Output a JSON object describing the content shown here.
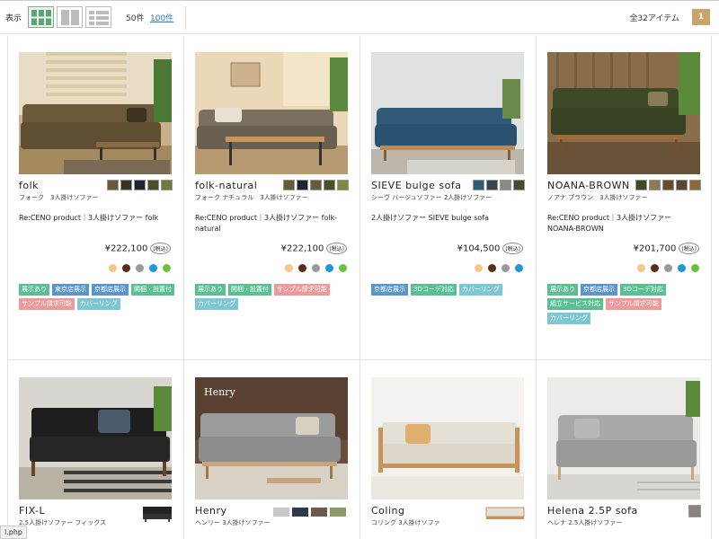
{
  "toolbar": {
    "display_label": "表示",
    "per_page_50": "50件",
    "per_page_100": "100件",
    "total": "全32アイテム",
    "page": "1"
  },
  "products": [
    {
      "name": "folk",
      "kana": "フォーク　3人掛けソファー",
      "desc": "Re:CENO product｜3人掛けソファー folk",
      "price": "¥222,100",
      "tax": "(税込)",
      "swatches": [
        "#6b5a3a",
        "#3b3226",
        "#1f2430",
        "#4a4f2a",
        "#6f7a3b"
      ],
      "dots": [
        "#f3c78a",
        "#5a2d16",
        "#9a9a9a",
        "#1a9ad6",
        "#6ac23a"
      ],
      "tags": [
        {
          "label": "展示あり",
          "color": "green"
        },
        {
          "label": "東京店展示",
          "color": "blue"
        },
        {
          "label": "京都店展示",
          "color": "blue"
        },
        {
          "label": "開梱・設置付",
          "color": "green"
        },
        {
          "label": "サンプル請求可能",
          "color": "pink"
        },
        {
          "label": "カバーリング",
          "color": "cyan"
        }
      ]
    },
    {
      "name": "folk-natural",
      "kana": "フォーク ナチュラル　3人掛けソファー",
      "desc": "Re:CENO product｜3人掛けソファー folk-natural",
      "price": "¥222,100",
      "tax": "(税込)",
      "swatches": [
        "#6b5a3a",
        "#1f2430",
        "#6a5a3a",
        "#4a4f2a",
        "#7d8a3b"
      ],
      "dots": [
        "#f3c78a",
        "#5a2d16",
        "#9a9a9a",
        "#1a9ad6",
        "#6ac23a"
      ],
      "tags": [
        {
          "label": "展示あり",
          "color": "green"
        },
        {
          "label": "開梱・設置付",
          "color": "green"
        },
        {
          "label": "サンプル請求可能",
          "color": "pink"
        },
        {
          "label": "カバーリング",
          "color": "cyan"
        }
      ]
    },
    {
      "name": "SIEVE bulge sofa",
      "kana": "シーヴ バージュソファー 2人掛けソファー",
      "desc": "2人掛けソファー SIEVE bulge sofa",
      "price": "¥104,500",
      "tax": "(税込)",
      "swatches": [
        "#2f5a78",
        "#3a4350",
        "#8a8a84",
        "#4b4a2f"
      ],
      "dots": [
        "#f3c78a",
        "#5a2d16",
        "#9a9a9a",
        "#1a9ad6"
      ],
      "tags": [
        {
          "label": "京都店展示",
          "color": "blue"
        },
        {
          "label": "3Dコーデ対応",
          "color": "green"
        },
        {
          "label": "カバーリング",
          "color": "cyan"
        }
      ]
    },
    {
      "name": "NOANA-BROWN",
      "kana": "ノアナ ブラウン　3人掛けソファー",
      "desc": "Re:CENO product｜3人掛けソファー NOANA-BROWN",
      "price": "¥201,700",
      "tax": "(税込)",
      "swatches": [
        "#3f4a28",
        "#8a7a55",
        "#6a4a2a",
        "#5a4630",
        "#8a6a3a"
      ],
      "dots": [
        "#f3c78a",
        "#5a2d16",
        "#9a9a9a",
        "#1a9ad6",
        "#6ac23a"
      ],
      "tags": [
        {
          "label": "展示あり",
          "color": "green"
        },
        {
          "label": "京都店展示",
          "color": "blue"
        },
        {
          "label": "3Dコーデ対応",
          "color": "green"
        },
        {
          "label": "組立サービス対応",
          "color": "green"
        },
        {
          "label": "サンプル請求可能",
          "color": "pink"
        },
        {
          "label": "カバーリング",
          "color": "cyan"
        }
      ]
    },
    {
      "name": "FIX-L",
      "kana": "2.5人掛けソファー フィックス",
      "thumb": "#222222"
    },
    {
      "name": "Henry",
      "kana": "ヘンリー 3人掛けソファー",
      "thumb": "#9a9a9a"
    },
    {
      "name": "Coling",
      "kana": "コリング 3人掛けソファ",
      "thumb": "#e5e0d6"
    },
    {
      "name": "Helena 2.5P sofa",
      "kana": "ヘレナ 2.5人掛けソファー",
      "thumb": "#8a8480"
    }
  ],
  "photo_overlay": {
    "henry_logo": "Henry"
  },
  "status_bar": {
    "text": "l.php"
  },
  "colors": {
    "tag_green": "#5bbf94",
    "tag_blue": "#5b95c9",
    "tag_pink": "#ec9a9a",
    "tag_cyan": "#7cc7d3",
    "page_badge": "#c9a46a",
    "link": "#2a7bbf"
  },
  "icons": {
    "view_grid_large": "grid-large-icon",
    "view_grid_small": "grid-small-icon",
    "view_list": "list-icon"
  }
}
